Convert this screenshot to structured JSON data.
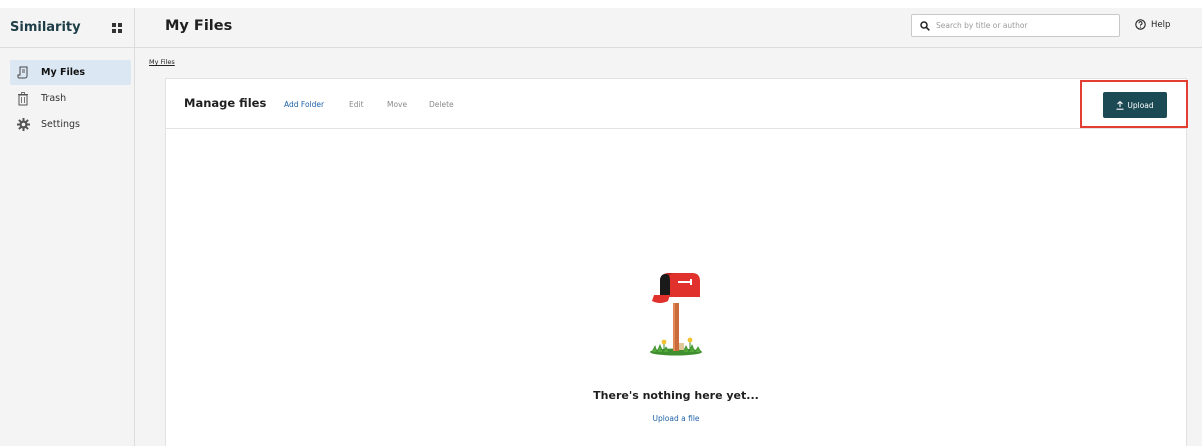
{
  "sidebar": {
    "brand": "Similarity",
    "items": [
      {
        "label": "My Files",
        "icon": "document-icon",
        "active": true
      },
      {
        "label": "Trash",
        "icon": "trash-icon",
        "active": false
      },
      {
        "label": "Settings",
        "icon": "gear-icon",
        "active": false
      }
    ]
  },
  "header": {
    "title": "My Files",
    "search_placeholder": "Search by title or author",
    "help_label": "Help"
  },
  "breadcrumb": "My Files",
  "panel": {
    "title": "Manage files",
    "actions": {
      "add_folder": "Add Folder",
      "edit": "Edit",
      "move": "Move",
      "delete": "Delete"
    },
    "upload_label": "Upload"
  },
  "empty_state": {
    "title": "There's nothing here yet...",
    "link": "Upload a file"
  },
  "colors": {
    "accent": "#1c4a54",
    "link": "#1f62a8",
    "highlight": "#e43d31",
    "active_nav": "#dbe7f3"
  }
}
